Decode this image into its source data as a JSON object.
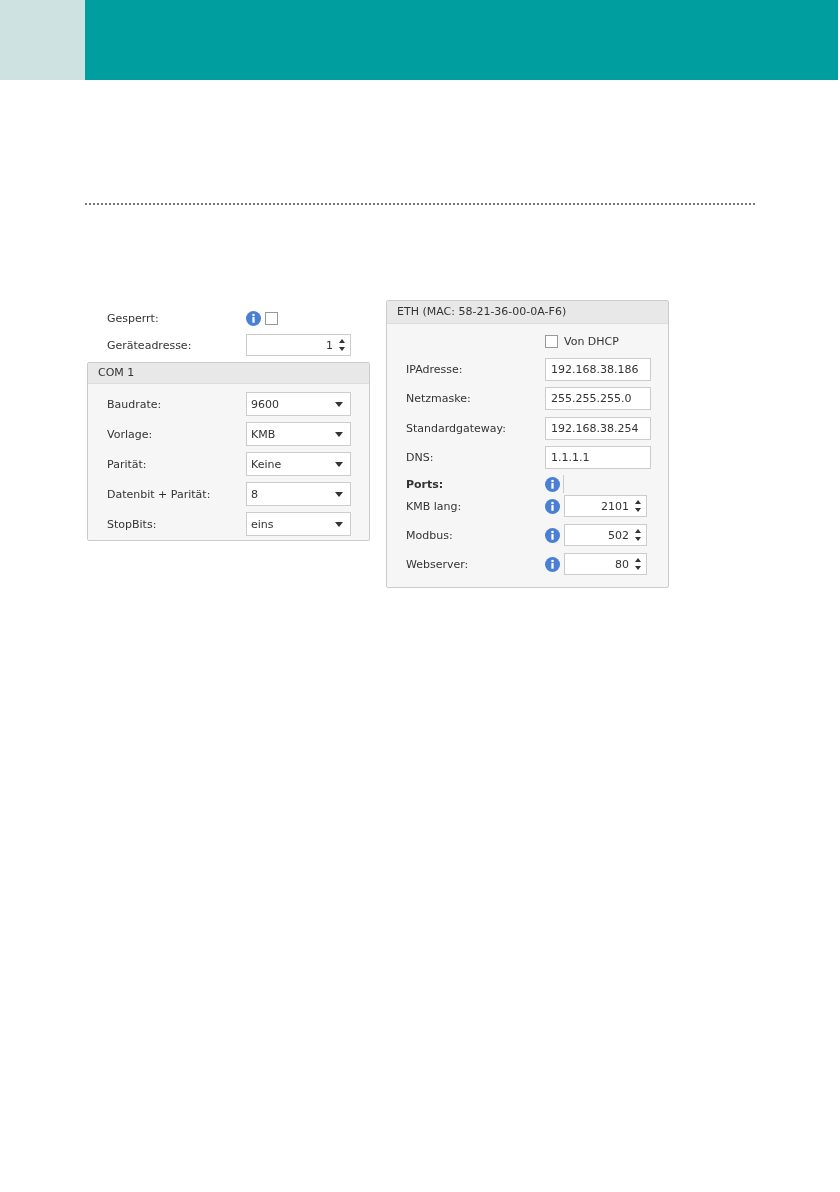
{
  "locked": {
    "label": "Gesperrt:",
    "checked": false
  },
  "device_address": {
    "label": "Geräteadresse:",
    "value": "1"
  },
  "com_group": {
    "title": "COM 1",
    "fields": [
      {
        "label": "Baudrate:",
        "value": "9600"
      },
      {
        "label": "Vorlage:",
        "value": "KMB"
      },
      {
        "label": "Parität:",
        "value": "Keine"
      },
      {
        "label": "Datenbit + Parität:",
        "value": "8"
      },
      {
        "label": "StopBits:",
        "value": "eins"
      }
    ]
  },
  "eth_group": {
    "title": "ETH (MAC: 58-21-36-00-0A-F6)",
    "dhcp": {
      "label": "Von DHCP",
      "checked": false
    },
    "fields": [
      {
        "label": "IPAdresse:",
        "value": "192.168.38.186"
      },
      {
        "label": "Netzmaske:",
        "value": "255.255.255.0"
      },
      {
        "label": "Standardgateway:",
        "value": "192.168.38.254"
      },
      {
        "label": "DNS:",
        "value": "1.1.1.1"
      }
    ],
    "ports_heading": "Ports:",
    "ports": [
      {
        "label": "KMB lang:",
        "value": "2101"
      },
      {
        "label": "Modbus:",
        "value": "502"
      },
      {
        "label": "Webserver:",
        "value": "80"
      }
    ]
  }
}
